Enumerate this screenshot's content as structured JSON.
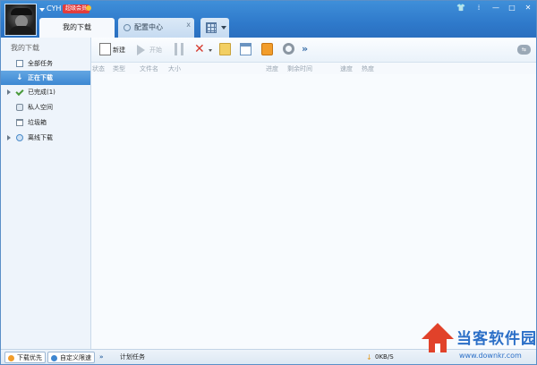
{
  "user": {
    "name": "CYH",
    "badge": "超级会员"
  },
  "tabs": [
    {
      "label": "我的下载"
    },
    {
      "label": "配置中心",
      "close": "x"
    }
  ],
  "window_controls": [
    "👕",
    "⁞",
    "—",
    "□",
    "✕"
  ],
  "sidebar": {
    "title": "我的下载",
    "items": [
      {
        "label": "全部任务",
        "icon": "document-icon"
      },
      {
        "label": "正在下载",
        "icon": "download-arrow-icon",
        "active": true
      },
      {
        "label": "已完成(1)",
        "icon": "check-icon",
        "expandable": true
      },
      {
        "label": "私人空间",
        "icon": "lock-icon"
      },
      {
        "label": "垃圾箱",
        "icon": "trash-icon"
      },
      {
        "label": "离线下载",
        "icon": "offline-icon",
        "expandable": true
      }
    ]
  },
  "toolbar": {
    "new_label": "新建",
    "start_label": "开始",
    "more": "»",
    "toggle": "⇆"
  },
  "columns": [
    "状态",
    "类型",
    "文件名",
    "大小",
    "进度",
    "剩余时间",
    "速度",
    "热度"
  ],
  "statusbar": {
    "priority_label": "下载优先",
    "custom_speed_label": "自定义限速",
    "more": "»",
    "schedule_label": "计划任务",
    "speed": "0KB/S"
  },
  "watermark": {
    "brand": "当客软件园",
    "url": "www.downkr.com"
  },
  "colors": {
    "titlebar": "#3f8fd9",
    "active_item": "#3d88d2",
    "watermark": "#2b6fc7"
  }
}
